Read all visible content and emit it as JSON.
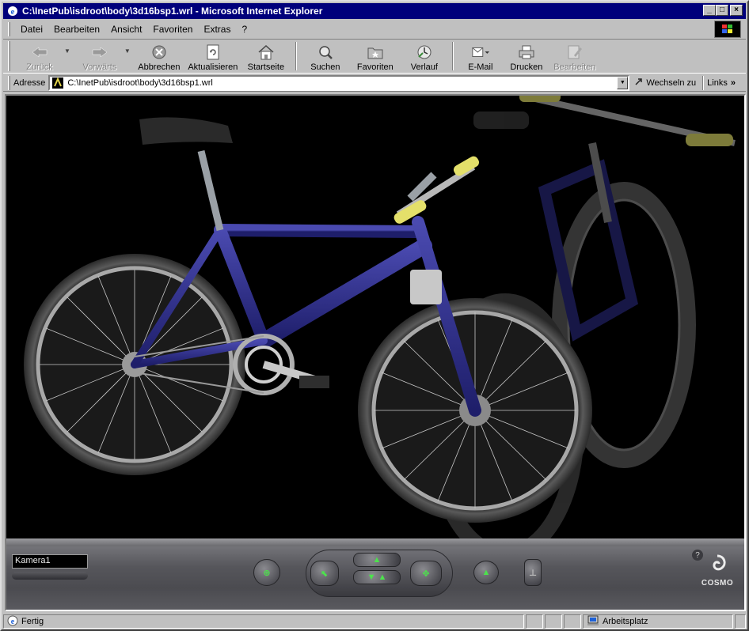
{
  "window": {
    "title": "C:\\InetPub\\isdroot\\body\\3d16bsp1.wrl - Microsoft Internet Explorer",
    "buttons": {
      "minimize": "_",
      "maximize": "□",
      "close": "×"
    }
  },
  "menu": [
    "Datei",
    "Bearbeiten",
    "Ansicht",
    "Favoriten",
    "Extras",
    "?"
  ],
  "toolbar": {
    "back": "Zurück",
    "forward": "Vorwärts",
    "stop": "Abbrechen",
    "refresh": "Aktualisieren",
    "home": "Startseite",
    "search": "Suchen",
    "favorites": "Favoriten",
    "history": "Verlauf",
    "mail": "E-Mail",
    "print": "Drucken",
    "edit": "Bearbeiten"
  },
  "address": {
    "label": "Adresse",
    "value": "C:\\InetPub\\isdroot\\body\\3d16bsp1.wrl",
    "go": "Wechseln zu",
    "links": "Links"
  },
  "cosmo": {
    "camera": "Kamera1",
    "logo": "COSMO",
    "help": "?"
  },
  "status": {
    "text": "Fertig",
    "zone": "Arbeitsplatz"
  },
  "colors": {
    "titlebar": "#00007b",
    "chrome": "#c0c0c0",
    "frame": "#2a2a8c",
    "tire": "#3a3a3a",
    "grip": "#e4e06a"
  }
}
